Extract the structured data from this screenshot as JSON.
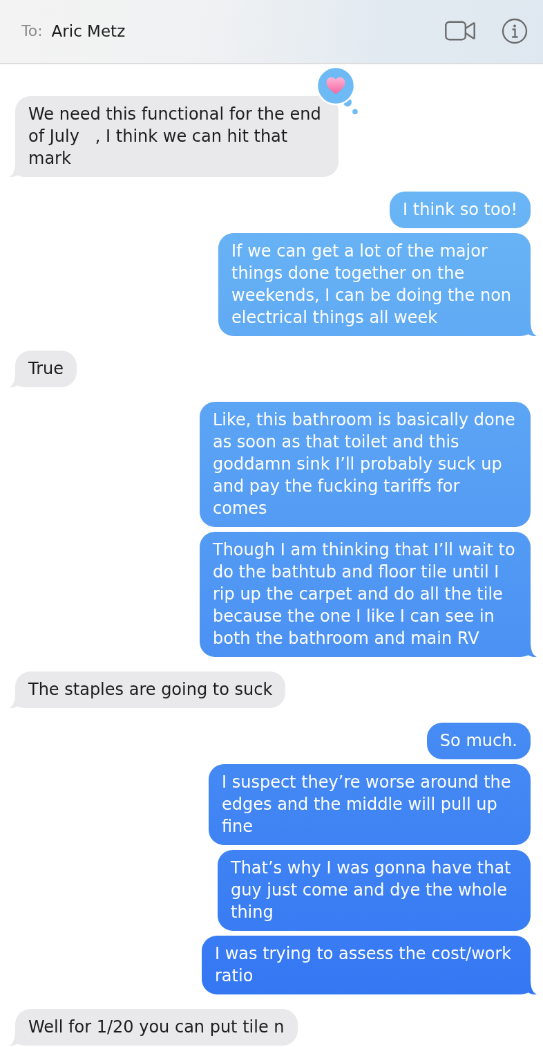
{
  "header": {
    "to_label": "To:",
    "recipient": "Aric Metz"
  },
  "messages": [
    {
      "kind": "received",
      "text": "We need this functional for the end of July   , I think we can hit that mark",
      "hearted": true
    },
    {
      "kind": "sent",
      "text": "I think so too!",
      "hearted": false
    },
    {
      "kind": "sent",
      "text": "If we can get a lot of the major things done together on the weekends, I can be doing the non electrical things all week",
      "hearted": false
    },
    {
      "kind": "received",
      "text": "True",
      "hearted": false
    },
    {
      "kind": "sent",
      "text": "Like, this bathroom is basically done as soon as that toilet and this goddamn sink I’ll probably suck up and pay the fucking tariffs for comes",
      "hearted": false
    },
    {
      "kind": "sent",
      "text": "Though I am thinking that I’ll wait to do the bathtub and floor tile until I rip up the carpet and do all the tile because the one I like I can see in both the bathroom and main RV",
      "hearted": false
    },
    {
      "kind": "received",
      "text": "The staples are going to suck",
      "hearted": false
    },
    {
      "kind": "sent",
      "text": "So much.",
      "hearted": false
    },
    {
      "kind": "sent",
      "text": "I suspect they’re worse around the edges and the middle will pull up fine",
      "hearted": false
    },
    {
      "kind": "sent",
      "text": "That’s why I was gonna have that guy just come and dye the whole thing",
      "hearted": false
    },
    {
      "kind": "sent",
      "text": "I was trying to assess the cost/work ratio",
      "hearted": false
    },
    {
      "kind": "received",
      "text": "Well for 1/20 you can put tile n",
      "hearted": false
    }
  ]
}
